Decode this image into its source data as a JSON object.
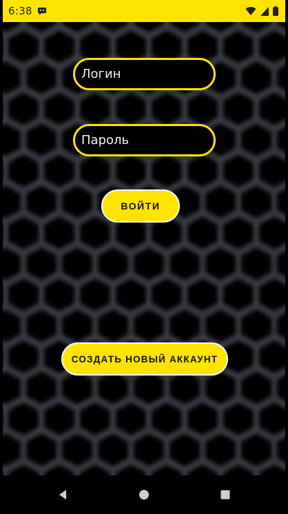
{
  "status_bar": {
    "time": "6:38",
    "icons": [
      "notification-icon",
      "wifi-icon",
      "signal-icon",
      "battery-icon"
    ],
    "background_color": "#FFE400"
  },
  "login_form": {
    "login_placeholder": "Логин",
    "password_placeholder": "Пароль",
    "login_button_label": "ВОЙТИ",
    "create_account_label": "СОЗДАТЬ НОВЫЙ АККАУНТ"
  },
  "theme": {
    "accent": "#FFE400",
    "background": "#000000",
    "pattern": "hexagon-grid"
  },
  "nav_bar": {
    "buttons": [
      "back-icon",
      "home-icon",
      "recents-icon"
    ]
  }
}
